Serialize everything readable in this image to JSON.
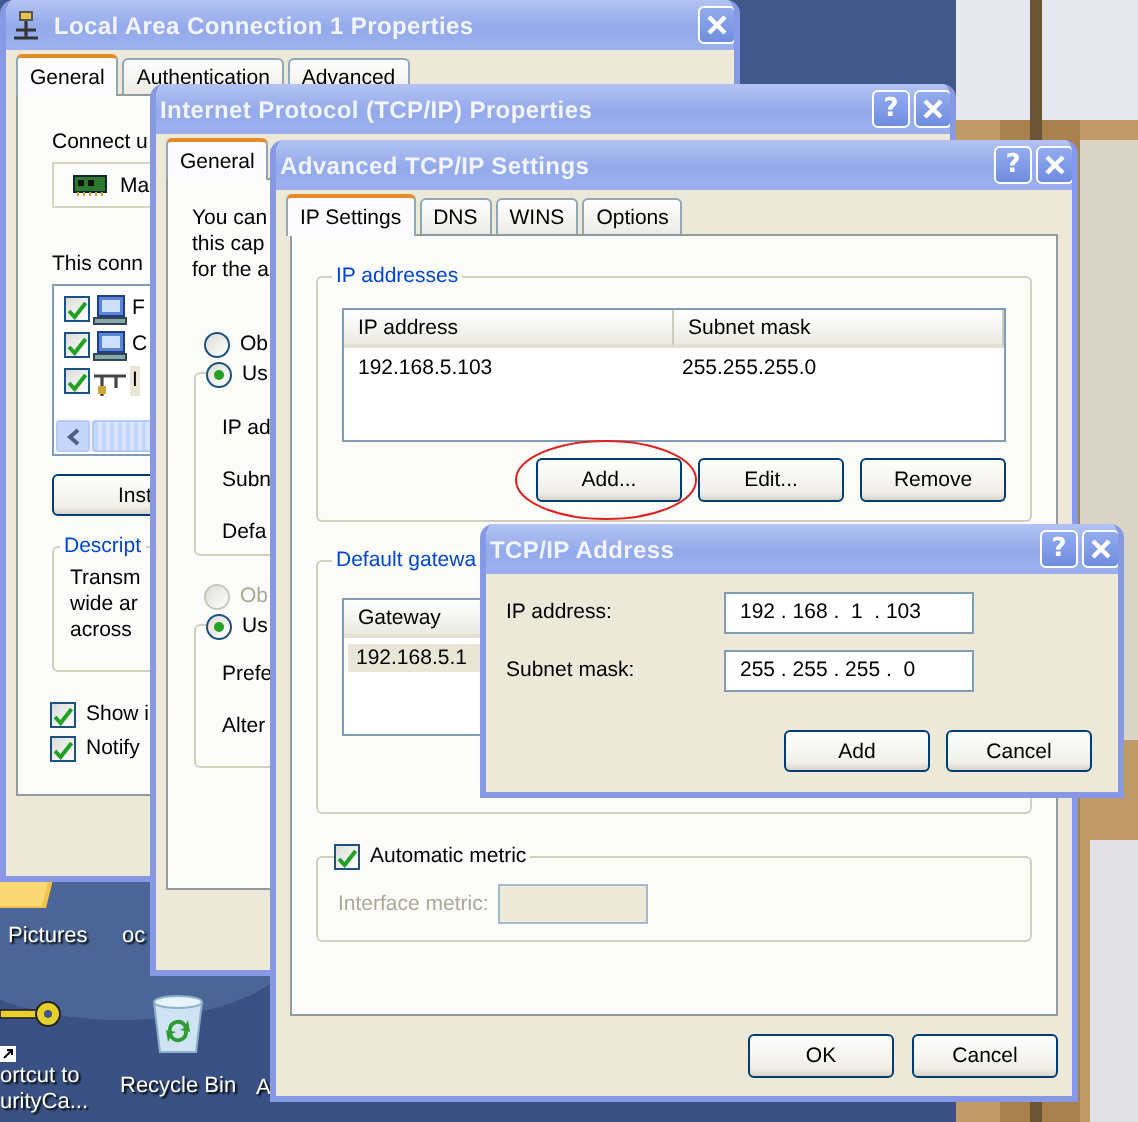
{
  "desktop": {
    "icons": [
      {
        "kind": "folder",
        "lines": [
          "Pictures"
        ]
      },
      {
        "kind": "label-only",
        "lines": [
          "oc"
        ]
      },
      {
        "kind": "key-shortcut",
        "lines": [
          "ortcut to",
          "urityCa..."
        ]
      },
      {
        "kind": "recycle-bin",
        "lines": [
          "Recycle Bin"
        ]
      },
      {
        "kind": "label-only",
        "lines": [
          "A"
        ]
      }
    ]
  },
  "local_area_window": {
    "title": "Local Area Connection 1 Properties",
    "tabs": [
      {
        "label": "General",
        "selected": true
      },
      {
        "label": "Authentication",
        "selected": false
      },
      {
        "label": "Advanced",
        "selected": false
      }
    ],
    "connect_label": "Connect u",
    "adapter": "Ma",
    "components_label": "This conn",
    "components": [
      {
        "kind": "client",
        "label": "F",
        "checked": true,
        "selected": false
      },
      {
        "kind": "client",
        "label": "C",
        "checked": true,
        "selected": false
      },
      {
        "kind": "protocol",
        "label": "I",
        "checked": true,
        "selected": true
      }
    ],
    "install_button": "Inst",
    "description": {
      "legend": "Descript",
      "lines": [
        "Transm",
        "wide ar",
        "across"
      ]
    },
    "options": [
      {
        "label": "Show i",
        "checked": true
      },
      {
        "label": "Notify",
        "checked": true
      }
    ]
  },
  "ip_properties_window": {
    "title": "Internet Protocol (TCP/IP) Properties",
    "help": "?",
    "tabs": [
      {
        "label": "General",
        "selected": true
      }
    ],
    "intro_lines": [
      "You can",
      "this cap",
      "for the a"
    ],
    "ip_mode": [
      {
        "label": "Ob",
        "selected": false,
        "disabled": false
      },
      {
        "label": "Us",
        "selected": true,
        "disabled": false
      }
    ],
    "ip_fields": [
      "IP ad",
      "Subn",
      "Defa"
    ],
    "dns_mode": [
      {
        "label": "Ob",
        "selected": false,
        "disabled": true
      },
      {
        "label": "Us",
        "selected": true,
        "disabled": false
      }
    ],
    "dns_fields": [
      "Prefe",
      "Alter"
    ]
  },
  "advanced_window": {
    "title": "Advanced TCP/IP Settings",
    "help": "?",
    "tabs": [
      {
        "label": "IP Settings",
        "selected": true
      },
      {
        "label": "DNS",
        "selected": false
      },
      {
        "label": "WINS",
        "selected": false
      },
      {
        "label": "Options",
        "selected": false
      }
    ],
    "ip_addresses": {
      "legend": "IP addresses",
      "columns": [
        "IP address",
        "Subnet mask"
      ],
      "rows": [
        {
          "cells": [
            "192.168.5.103",
            "255.255.255.0"
          ],
          "selected": false
        }
      ],
      "buttons": [
        {
          "label": "Add...",
          "circled": true
        },
        {
          "label": "Edit...",
          "circled": false
        },
        {
          "label": "Remove",
          "circled": false
        }
      ]
    },
    "gateways": {
      "legend": "Default gatewa",
      "columns": [
        "Gateway"
      ],
      "rows": [
        {
          "cells": [
            "192.168.5.1"
          ],
          "selected": true
        }
      ]
    },
    "automatic_metric": {
      "label": "Automatic metric",
      "checked": true
    },
    "interface_metric": {
      "label": "Interface metric:",
      "disabled": true
    },
    "buttons": [
      "OK",
      "Cancel"
    ]
  },
  "address_dialog": {
    "title": "TCP/IP Address",
    "help": "?",
    "fields": [
      {
        "label": "IP address:",
        "value": "192 . 168 .  1  . 103"
      },
      {
        "label": "Subnet mask:",
        "value": "255 . 255 . 255 .  0"
      }
    ],
    "buttons": [
      "Add",
      "Cancel"
    ]
  }
}
